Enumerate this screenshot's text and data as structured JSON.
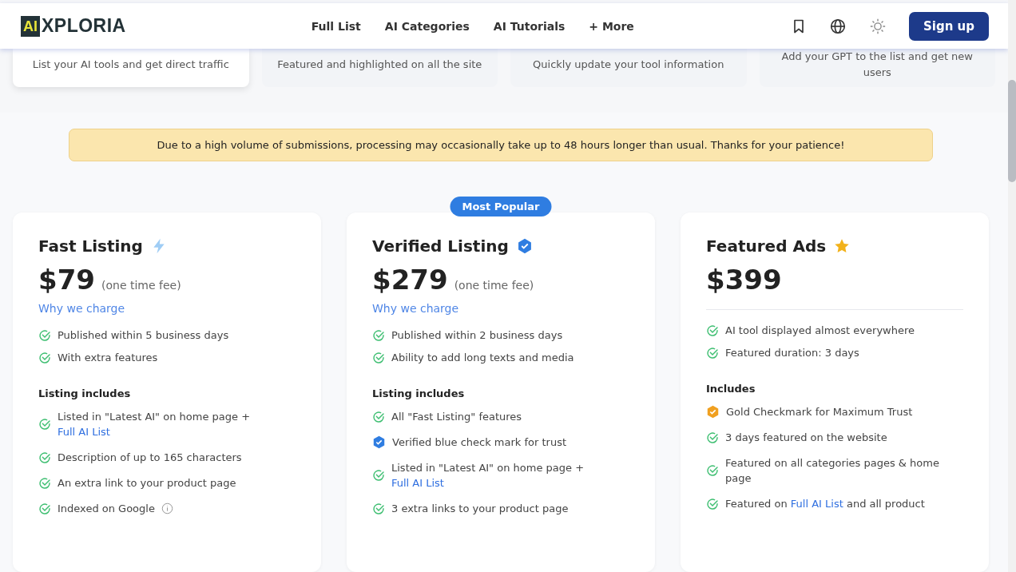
{
  "header": {
    "logo_mark": "AI",
    "logo_text": "XPLORIA",
    "nav": [
      "Full List",
      "AI Categories",
      "AI Tutorials",
      "+ More"
    ],
    "signup": "Sign up"
  },
  "top_cards": [
    {
      "description": "List your AI tools and get direct traffic",
      "selected": true
    },
    {
      "description": "Featured and highlighted on all the site",
      "selected": false
    },
    {
      "description": "Quickly update your tool information",
      "selected": false
    },
    {
      "description": "Add your GPT to the list and get new users",
      "selected": false
    }
  ],
  "notice": "Due to a high volume of submissions, processing may occasionally take up to 48 hours longer than usual. Thanks for your patience!",
  "plans": [
    {
      "title": "Fast Listing",
      "kind": "fast",
      "price": "$79",
      "price_note": "(one time fee)",
      "why_link": "Why we charge",
      "highlights": [
        "Published within 5 business days",
        "With extra features"
      ],
      "includes_title": "Listing includes",
      "includes": [
        {
          "kind": "check",
          "parts": [
            {
              "text": "Listed in \"Latest AI\" on home page + "
            },
            {
              "link": "Full AI List"
            }
          ]
        },
        {
          "kind": "check",
          "parts": [
            {
              "text": "Description of up to 165 characters"
            }
          ]
        },
        {
          "kind": "check",
          "parts": [
            {
              "text": "An extra link to your product page"
            }
          ]
        },
        {
          "kind": "check",
          "parts": [
            {
              "text": "Indexed on Google"
            }
          ],
          "info": true
        }
      ]
    },
    {
      "title": "Verified Listing",
      "kind": "verified",
      "badge": "Most Popular",
      "price": "$279",
      "price_note": "(one time fee)",
      "why_link": "Why we charge",
      "highlights": [
        "Published within 2 business days",
        "Ability to add long texts and media"
      ],
      "includes_title": "Listing includes",
      "includes": [
        {
          "kind": "check",
          "parts": [
            {
              "text": "All \"Fast Listing\" features"
            }
          ]
        },
        {
          "kind": "blue-badge",
          "parts": [
            {
              "text": "Verified blue check mark for trust"
            }
          ]
        },
        {
          "kind": "check",
          "parts": [
            {
              "text": "Listed in \"Latest AI\" on home page + "
            },
            {
              "link": "Full AI List"
            }
          ]
        },
        {
          "kind": "check",
          "parts": [
            {
              "text": "3 extra links to your product page"
            }
          ]
        }
      ]
    },
    {
      "title": "Featured Ads",
      "kind": "featured",
      "price": "$399",
      "highlights": [
        "AI tool displayed almost everywhere",
        "Featured duration: 3 days"
      ],
      "includes_title": "Includes",
      "includes": [
        {
          "kind": "premium-badge",
          "parts": [
            {
              "text": "Gold Checkmark for Maximum Trust"
            }
          ]
        },
        {
          "kind": "check",
          "parts": [
            {
              "text": "3 days featured on the website"
            }
          ]
        },
        {
          "kind": "check",
          "parts": [
            {
              "text": "Featured on all categories pages & home page"
            }
          ]
        },
        {
          "kind": "check",
          "parts": [
            {
              "text": "Featured on "
            },
            {
              "link": "Full AI List"
            },
            {
              "text": " and all product"
            }
          ]
        }
      ]
    }
  ]
}
